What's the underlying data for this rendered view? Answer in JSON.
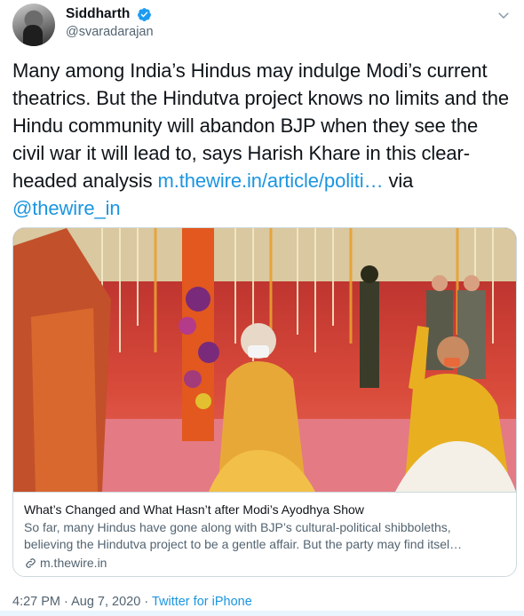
{
  "user": {
    "display_name": "Siddharth",
    "handle": "@svaradarajan"
  },
  "tweet": {
    "text_part1": "Many among India’s Hindus may indulge Modi’s current theatrics. But the Hindutva project knows no limits and the Hindu community will abandon BJP when they see the civil war it will lead to, says Harish Khare in this clear-headed analysis ",
    "link_text": "m.thewire.in/article/politi…",
    "text_via": " via ",
    "mention": "@thewire_in"
  },
  "card": {
    "title": "What’s Changed and What Hasn’t after Modi’s Ayodhya Show",
    "desc_line1": "So far, many Hindus have gone along with BJP’s cultural-political shibboleths,",
    "desc_line2": "believing the Hindutva project to be a gentle affair. But the party may find itsel…",
    "domain": "m.thewire.in"
  },
  "footer": {
    "time": "4:27 PM",
    "separator1": " · ",
    "date": "Aug 7, 2020",
    "separator2": " · ",
    "source": "Twitter for iPhone"
  },
  "colors": {
    "link": "#1b95e0",
    "verified": "#1d9bf0",
    "muted": "#536471"
  },
  "icons": [
    "verified-badge-icon",
    "chevron-down-icon",
    "link-icon"
  ]
}
